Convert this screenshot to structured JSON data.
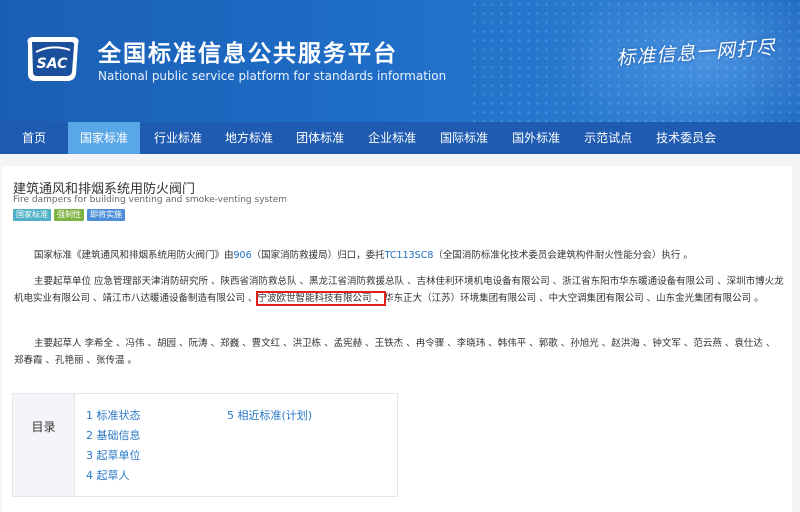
{
  "header": {
    "title_cn": "全国标准信息公共服务平台",
    "title_en": "National public service platform  for standards information",
    "logo_text": "SAC",
    "slogan": "标准信息一网打尽"
  },
  "nav": {
    "items": [
      "首页",
      "国家标准",
      "行业标准",
      "地方标准",
      "团体标准",
      "企业标准",
      "国际标准",
      "国外标准",
      "示范试点",
      "技术委员会"
    ],
    "active_index": 1
  },
  "standard": {
    "title": "建筑通风和排烟系统用防火阀门",
    "title_en": "Fire dampers for building venting and smoke-venting system",
    "tags": [
      "国家标准",
      "强制性",
      "即将实施"
    ]
  },
  "paragraph1": {
    "prefix": "国家标准《建筑通风和排烟系统用防火阀门》由",
    "code1": "906",
    "middle": "（国家消防救援局）归口，委托",
    "code2": "TC113SC8",
    "suffix": "（全国消防标准化技术委员会建筑构件耐火性能分会）执行 。"
  },
  "paragraph2": {
    "before": "主要起草单位 应急管理部天津消防研究所 、陕西省消防救总队 、黑龙江省消防救援总队 、吉林佳利环境机电设备有限公司 、浙江省东阳市华东暖通设备有限公司 、深圳市博火龙机电实业有限公司 、靖江市八达暖通设备制造有限公司 、",
    "highlight": "宁波欧世智能科技有限公司 、",
    "after": "华东正大（江苏）环境集团有限公司 、中大空调集团有限公司 、山东金光集团有限公司 。"
  },
  "paragraph3": {
    "text": "主要起草人 李希全 、冯伟 、胡园 、阮涛 、郑巍 、曹文红 、洪卫栋 、孟宪赫 、王铁杰 、冉令骤 、李晓玮 、韩伟平 、郭歌 、孙旭光 、赵洪海 、钟文军 、范云燕 、袁仕达 、郑春霞 、孔艳丽 、张传温 。"
  },
  "toc": {
    "label": "目录",
    "items": [
      "1  标准状态",
      "2  基础信息",
      "3  起草单位",
      "4  起草人",
      "5  相近标准(计划)"
    ]
  }
}
